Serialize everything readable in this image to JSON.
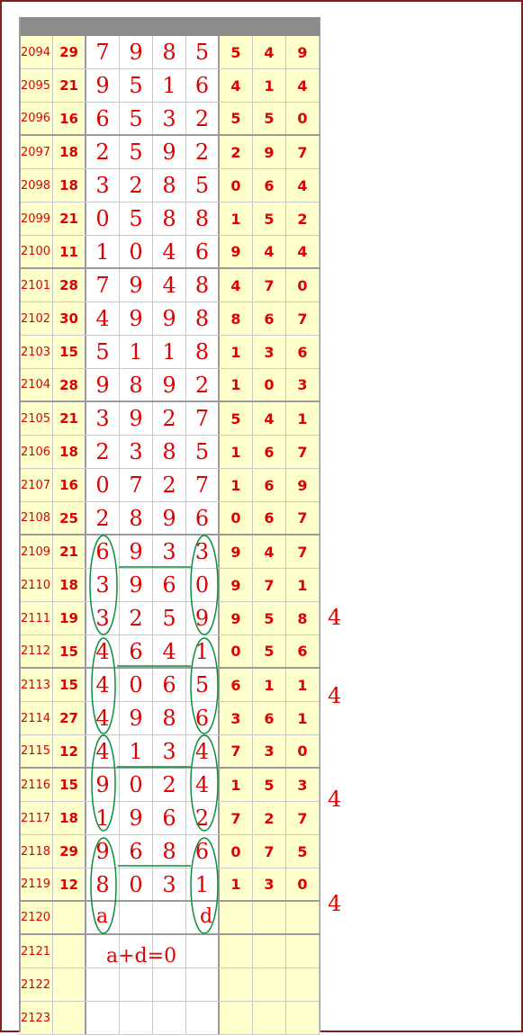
{
  "rows": [
    {
      "id": "2094",
      "sum": "29",
      "d": [
        "7",
        "9",
        "8",
        "5"
      ],
      "s": [
        "5",
        "4",
        "9"
      ]
    },
    {
      "id": "2095",
      "sum": "21",
      "d": [
        "9",
        "5",
        "1",
        "6"
      ],
      "s": [
        "4",
        "1",
        "4"
      ]
    },
    {
      "id": "2096",
      "sum": "16",
      "d": [
        "6",
        "5",
        "3",
        "2"
      ],
      "s": [
        "5",
        "5",
        "0"
      ]
    },
    {
      "id": "2097",
      "sum": "18",
      "d": [
        "2",
        "5",
        "9",
        "2"
      ],
      "s": [
        "2",
        "9",
        "7"
      ]
    },
    {
      "id": "2098",
      "sum": "18",
      "d": [
        "3",
        "2",
        "8",
        "5"
      ],
      "s": [
        "0",
        "6",
        "4"
      ]
    },
    {
      "id": "2099",
      "sum": "21",
      "d": [
        "0",
        "5",
        "8",
        "8"
      ],
      "s": [
        "1",
        "5",
        "2"
      ]
    },
    {
      "id": "2100",
      "sum": "11",
      "d": [
        "1",
        "0",
        "4",
        "6"
      ],
      "s": [
        "9",
        "4",
        "4"
      ]
    },
    {
      "id": "2101",
      "sum": "28",
      "d": [
        "7",
        "9",
        "4",
        "8"
      ],
      "s": [
        "4",
        "7",
        "0"
      ]
    },
    {
      "id": "2102",
      "sum": "30",
      "d": [
        "4",
        "9",
        "9",
        "8"
      ],
      "s": [
        "8",
        "6",
        "7"
      ]
    },
    {
      "id": "2103",
      "sum": "15",
      "d": [
        "5",
        "1",
        "1",
        "8"
      ],
      "s": [
        "1",
        "3",
        "6"
      ]
    },
    {
      "id": "2104",
      "sum": "28",
      "d": [
        "9",
        "8",
        "9",
        "2"
      ],
      "s": [
        "1",
        "0",
        "3"
      ]
    },
    {
      "id": "2105",
      "sum": "21",
      "d": [
        "3",
        "9",
        "2",
        "7"
      ],
      "s": [
        "5",
        "4",
        "1"
      ]
    },
    {
      "id": "2106",
      "sum": "18",
      "d": [
        "2",
        "3",
        "8",
        "5"
      ],
      "s": [
        "1",
        "6",
        "7"
      ]
    },
    {
      "id": "2107",
      "sum": "16",
      "d": [
        "0",
        "7",
        "2",
        "7"
      ],
      "s": [
        "1",
        "6",
        "9"
      ]
    },
    {
      "id": "2108",
      "sum": "25",
      "d": [
        "2",
        "8",
        "9",
        "6"
      ],
      "s": [
        "0",
        "6",
        "7"
      ]
    },
    {
      "id": "2109",
      "sum": "21",
      "d": [
        "6",
        "9",
        "3",
        "3"
      ],
      "s": [
        "9",
        "4",
        "7"
      ]
    },
    {
      "id": "2110",
      "sum": "18",
      "d": [
        "3",
        "9",
        "6",
        "0"
      ],
      "s": [
        "9",
        "7",
        "1"
      ]
    },
    {
      "id": "2111",
      "sum": "19",
      "d": [
        "3",
        "2",
        "5",
        "9"
      ],
      "s": [
        "9",
        "5",
        "8"
      ]
    },
    {
      "id": "2112",
      "sum": "15",
      "d": [
        "4",
        "6",
        "4",
        "1"
      ],
      "s": [
        "0",
        "5",
        "6"
      ]
    },
    {
      "id": "2113",
      "sum": "15",
      "d": [
        "4",
        "0",
        "6",
        "5"
      ],
      "s": [
        "6",
        "1",
        "1"
      ]
    },
    {
      "id": "2114",
      "sum": "27",
      "d": [
        "4",
        "9",
        "8",
        "6"
      ],
      "s": [
        "3",
        "6",
        "1"
      ]
    },
    {
      "id": "2115",
      "sum": "12",
      "d": [
        "4",
        "1",
        "3",
        "4"
      ],
      "s": [
        "7",
        "3",
        "0"
      ]
    },
    {
      "id": "2116",
      "sum": "15",
      "d": [
        "9",
        "0",
        "2",
        "4"
      ],
      "s": [
        "1",
        "5",
        "3"
      ]
    },
    {
      "id": "2117",
      "sum": "18",
      "d": [
        "1",
        "9",
        "6",
        "2"
      ],
      "s": [
        "7",
        "2",
        "7"
      ]
    },
    {
      "id": "2118",
      "sum": "29",
      "d": [
        "9",
        "6",
        "8",
        "6"
      ],
      "s": [
        "0",
        "7",
        "5"
      ]
    },
    {
      "id": "2119",
      "sum": "12",
      "d": [
        "8",
        "0",
        "3",
        "1"
      ],
      "s": [
        "1",
        "3",
        "0"
      ]
    },
    {
      "id": "2120",
      "sum": "",
      "d": [
        "",
        "",
        "",
        ""
      ],
      "s": [
        "",
        "",
        ""
      ]
    },
    {
      "id": "2121",
      "sum": "",
      "d": [
        "",
        "",
        "",
        ""
      ],
      "s": [
        "",
        "",
        ""
      ]
    },
    {
      "id": "2122",
      "sum": "",
      "d": [
        "",
        "",
        "",
        ""
      ],
      "s": [
        "",
        "",
        ""
      ]
    },
    {
      "id": "2123",
      "sum": "",
      "d": [
        "",
        "",
        "",
        ""
      ],
      "s": [
        "",
        "",
        ""
      ]
    }
  ],
  "annotations": {
    "side_notes": [
      "4",
      "4",
      "4",
      "4"
    ],
    "label_a": "a",
    "label_d": "d",
    "formula": "a+d=0"
  },
  "colors": {
    "text": "#e00000",
    "highlight": "#ffffcc",
    "mark": "#0a8f3c",
    "header": "#8c8c8c",
    "frame": "#8b1a1a"
  }
}
